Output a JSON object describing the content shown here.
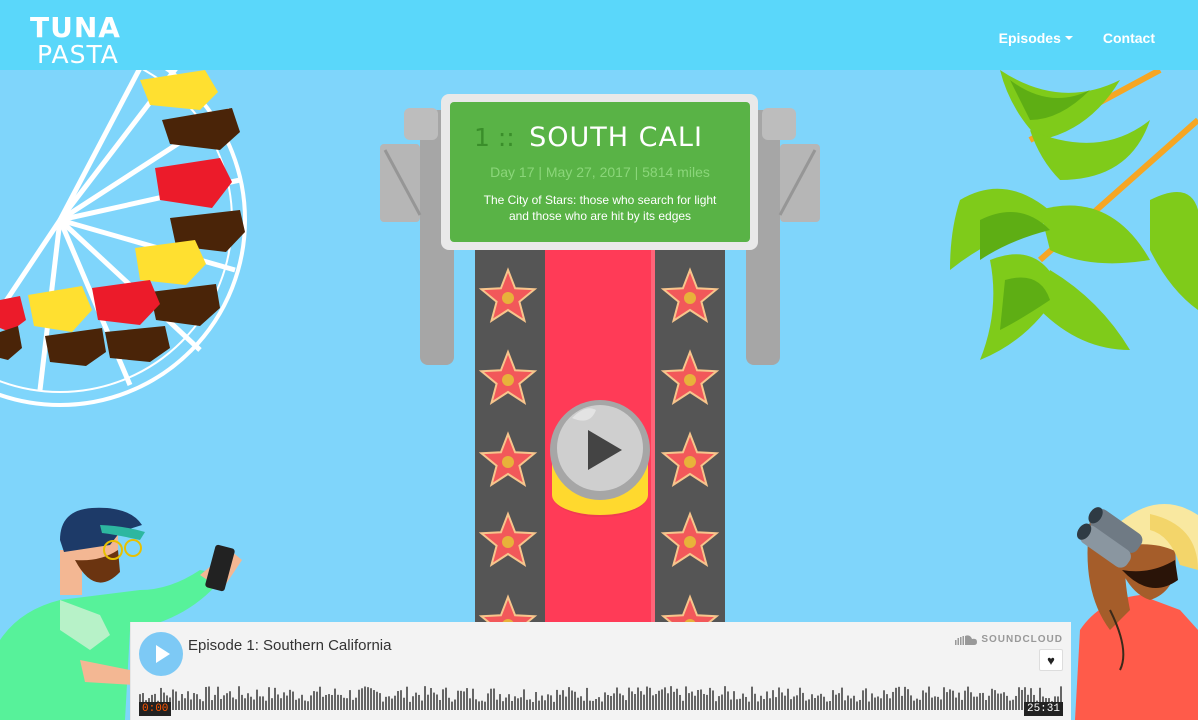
{
  "brand": {
    "line1": "TUNA",
    "line2": "PASTA"
  },
  "nav": {
    "episodes_label": "Episodes",
    "contact_label": "Contact"
  },
  "sign": {
    "number": "1 ::",
    "title": "SOUTH CALI",
    "meta": "Day 17 | May 27, 2017 | 5814 miles",
    "description": "The City of Stars: those who search for light and those who are hit by its edges"
  },
  "player": {
    "title": "Episode 1: Southern California",
    "brand_label": "SOUNDCLOUD",
    "time_start": "0:00",
    "time_end": "25:31",
    "progress": 0
  },
  "colors": {
    "sky": "#7fd5fb",
    "navbar": "#5ad7fa",
    "sign_green": "#59b346",
    "carpet": "#ff3b57",
    "walk": "#555555",
    "star": "#f2585a"
  },
  "icons": {
    "episodes_caret": "chevron-down-icon",
    "play": "play-icon",
    "soundcloud": "soundcloud-icon",
    "like": "heart-icon"
  }
}
